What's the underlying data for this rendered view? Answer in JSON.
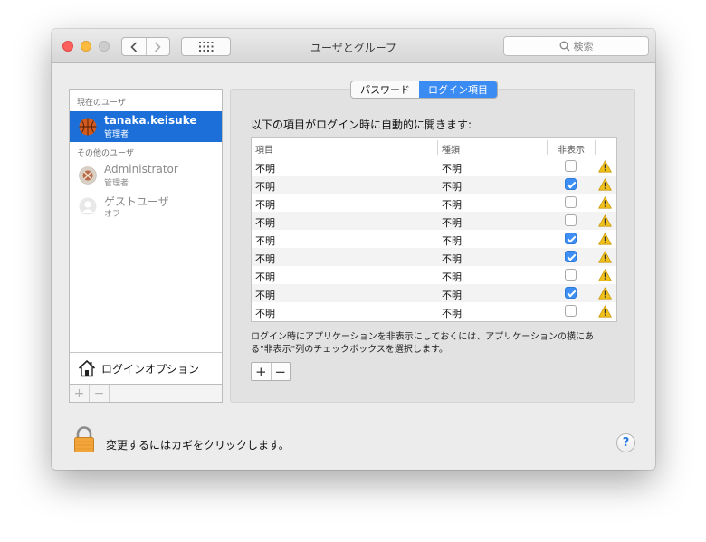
{
  "window": {
    "title": "ユーザとグループ"
  },
  "search": {
    "placeholder": "検索"
  },
  "sidebar": {
    "current_header": "現在のユーザ",
    "current_user": {
      "name": "tanaka.keisuke",
      "role": "管理者"
    },
    "other_header": "その他のユーザ",
    "other_users": [
      {
        "name": "Administrator",
        "role": "管理者"
      },
      {
        "name": "ゲストユーザ",
        "role": "オフ"
      }
    ],
    "login_options": "ログインオプション",
    "add_symbol": "+",
    "remove_symbol": "−"
  },
  "tabs": [
    {
      "label": "パスワード",
      "active": false
    },
    {
      "label": "ログイン項目",
      "active": true
    }
  ],
  "panel": {
    "title": "以下の項目がログイン時に自動的に開きます:",
    "columns": {
      "item": "項目",
      "kind": "種類",
      "hide": "非表示"
    },
    "rows": [
      {
        "item": "不明",
        "kind": "不明",
        "hidden": false
      },
      {
        "item": "不明",
        "kind": "不明",
        "hidden": true
      },
      {
        "item": "不明",
        "kind": "不明",
        "hidden": false
      },
      {
        "item": "不明",
        "kind": "不明",
        "hidden": false
      },
      {
        "item": "不明",
        "kind": "不明",
        "hidden": true
      },
      {
        "item": "不明",
        "kind": "不明",
        "hidden": true
      },
      {
        "item": "不明",
        "kind": "不明",
        "hidden": false
      },
      {
        "item": "不明",
        "kind": "不明",
        "hidden": true
      },
      {
        "item": "不明",
        "kind": "不明",
        "hidden": false
      }
    ],
    "note_line1": "ログイン時にアプリケーションを非表示にしておくには、アプリケーションの横にあ",
    "note_line2": "る\"非表示\"列のチェックボックスを選択します。",
    "add_symbol": "+",
    "remove_symbol": "−"
  },
  "footer": {
    "lock_text": "変更するにはカギをクリックします。",
    "help_symbol": "?"
  },
  "icons": {
    "back": "chevron-left-icon",
    "forward": "chevron-right-icon",
    "grid": "grid-icon",
    "search": "search-icon",
    "warning": "warning-icon",
    "lock": "lock-icon",
    "house": "house-icon"
  },
  "colors": {
    "selection": "#1c6fd9",
    "tab_active": "#3a8cf2",
    "checkbox_on": "#3d8ff5",
    "warning": "#f2c21b"
  }
}
